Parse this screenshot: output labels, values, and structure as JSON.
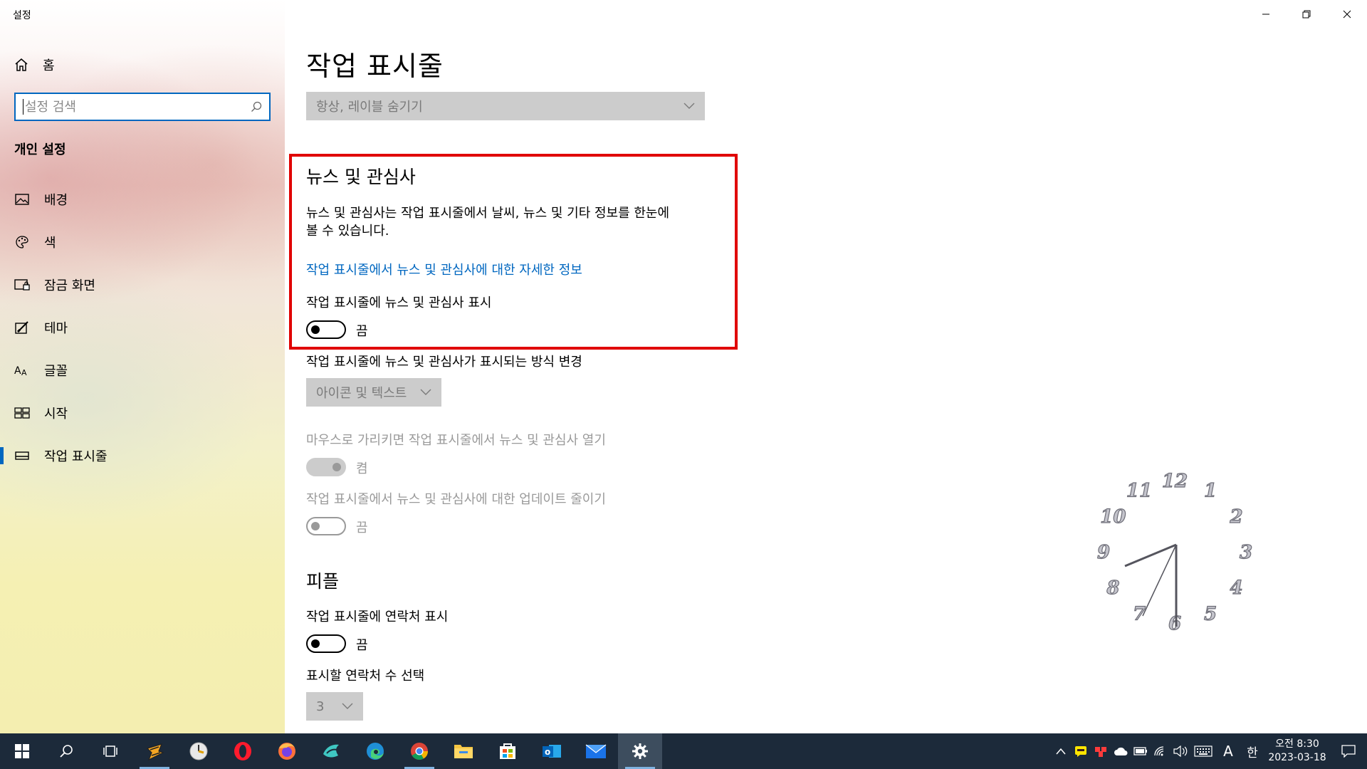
{
  "window": {
    "title": "설정"
  },
  "sidebar": {
    "home_label": "홈",
    "search_placeholder": "설정 검색",
    "section_title": "개인 설정",
    "items": [
      {
        "label": "배경",
        "icon": "image-icon"
      },
      {
        "label": "색",
        "icon": "palette-icon"
      },
      {
        "label": "잠금 화면",
        "icon": "lock-screen-icon"
      },
      {
        "label": "테마",
        "icon": "theme-brush-icon"
      },
      {
        "label": "글꼴",
        "icon": "font-icon"
      },
      {
        "label": "시작",
        "icon": "start-icon"
      },
      {
        "label": "작업 표시줄",
        "icon": "taskbar-icon",
        "active": true
      }
    ]
  },
  "main": {
    "title": "작업 표시줄",
    "combine_dropdown": "항상, 레이블 숨기기",
    "news": {
      "heading": "뉴스 및 관심사",
      "description_line1": "뉴스 및 관심사는 작업 표시줄에서 날씨, 뉴스 및 기타 정보를 한눈에",
      "description_line2": "볼 수 있습니다.",
      "link": "작업 표시줄에서 뉴스 및 관심사에 대한 자세한 정보",
      "show_label": "작업 표시줄에 뉴스 및 관심사 표시",
      "show_state": "끔",
      "display_mode_label": "작업 표시줄에 뉴스 및 관심사가 표시되는 방식 변경",
      "display_mode_value": "아이콘 및 텍스트",
      "hover_label": "마우스로 가리키면 작업 표시줄에서 뉴스 및 관심사 열기",
      "hover_state": "켬",
      "reduce_label": "작업 표시줄에서 뉴스 및 관심사에 대한 업데이트 줄이기",
      "reduce_state": "끔"
    },
    "people": {
      "heading": "피플",
      "contacts_label": "작업 표시줄에 연락처 표시",
      "contacts_state": "끔",
      "count_label": "표시할 연락처 수 선택",
      "count_value": "3"
    }
  },
  "desktop_clock": {
    "numerals": [
      "12",
      "1",
      "2",
      "3",
      "4",
      "5",
      "6",
      "7",
      "8",
      "9",
      "10",
      "11"
    ]
  },
  "taskbar": {
    "apps": [
      "start-icon",
      "search-icon",
      "task-view-icon",
      "winamp-icon",
      "clock-app-icon",
      "opera-icon",
      "firefox-icon",
      "bird-app-icon",
      "edge-icon",
      "chrome-icon",
      "file-explorer-icon",
      "store-icon",
      "outlook-icon",
      "mail-icon",
      "settings-icon"
    ],
    "tray": {
      "ime_mode": "A",
      "ime_lang": "한",
      "time_period": "오전 8:30",
      "date": "2023-03-18"
    }
  },
  "colors": {
    "accent": "#0067c0",
    "highlight_border": "#e00000",
    "taskbar": "#1c2a3a"
  }
}
